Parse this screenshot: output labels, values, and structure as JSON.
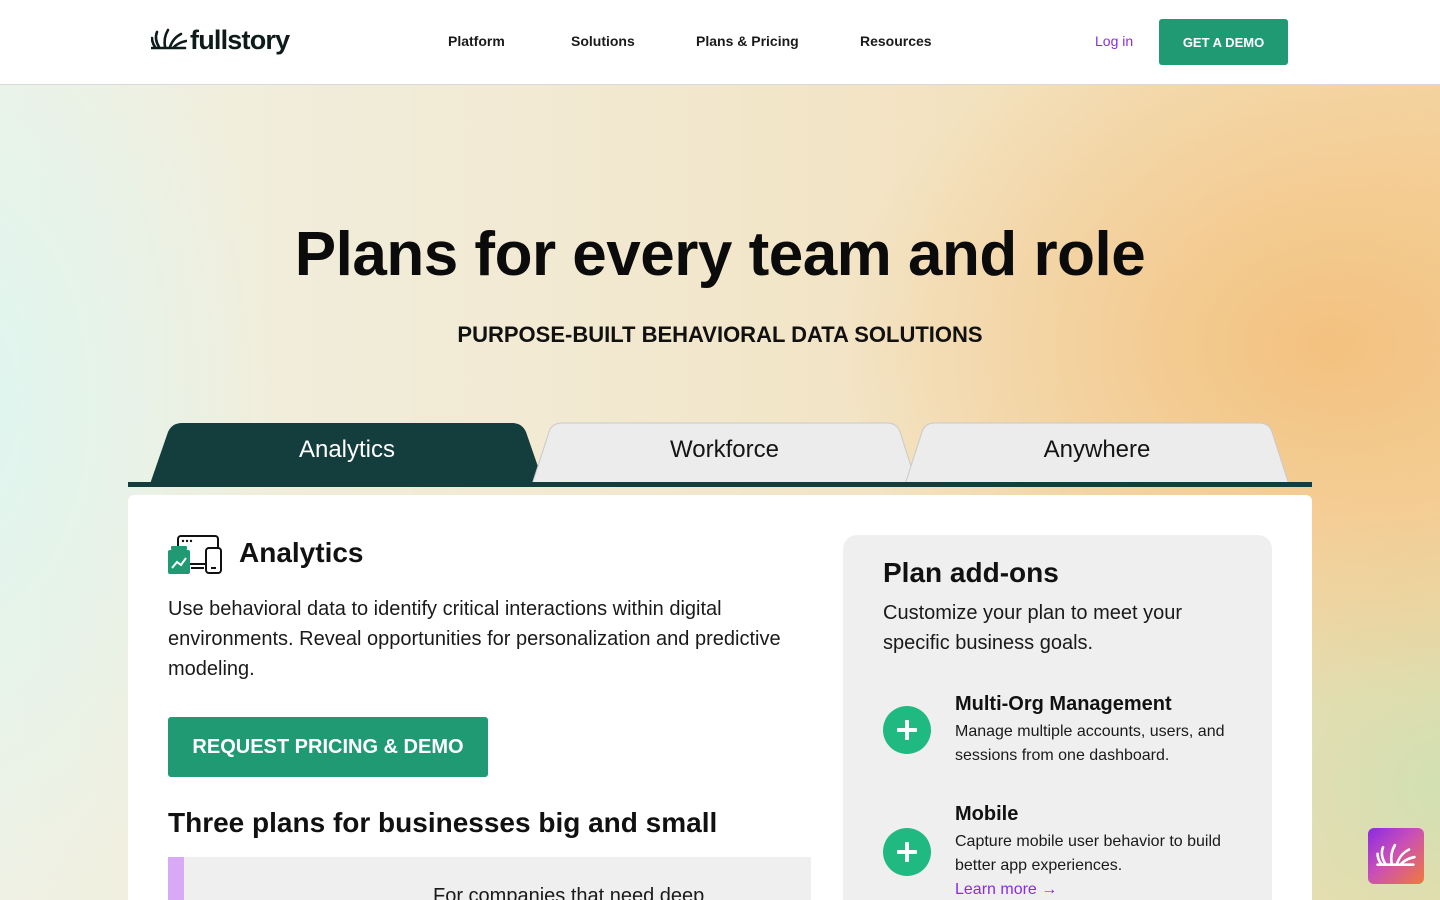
{
  "brand": {
    "name": "fullstory",
    "accent": "#1f9a73",
    "link_color": "#8a2be2",
    "dark_tab": "#143d3d"
  },
  "nav": {
    "items": [
      "Platform",
      "Solutions",
      "Plans & Pricing",
      "Resources"
    ],
    "login": "Log in",
    "demo_button": "GET A DEMO"
  },
  "hero": {
    "title": "Plans for every team and role",
    "subtitle": "PURPOSE-BUILT BEHAVIORAL DATA SOLUTIONS"
  },
  "tabs": {
    "items": [
      "Analytics",
      "Workforce",
      "Anywhere"
    ],
    "selected": "Analytics"
  },
  "analytics": {
    "icon": "devices-chart-icon",
    "title": "Analytics",
    "description": "Use behavioral data to identify critical interactions within digital environments. Reveal opportunities for personalization and predictive modeling.",
    "cta": "REQUEST PRICING & DEMO",
    "plans_heading": "Three plans for businesses big and small",
    "plan_teaser": "For companies that need deep"
  },
  "addons": {
    "title": "Plan add-ons",
    "description": "Customize your plan to meet your specific business goals.",
    "items": [
      {
        "name": "Multi-Org Management",
        "description": "Manage multiple accounts, users, and sessions from one dashboard."
      },
      {
        "name": "Mobile",
        "description": "Capture mobile user behavior to build better app experiences.",
        "link": "Learn more →"
      }
    ]
  },
  "widget": {
    "icon": "fullstory-burst-icon"
  }
}
